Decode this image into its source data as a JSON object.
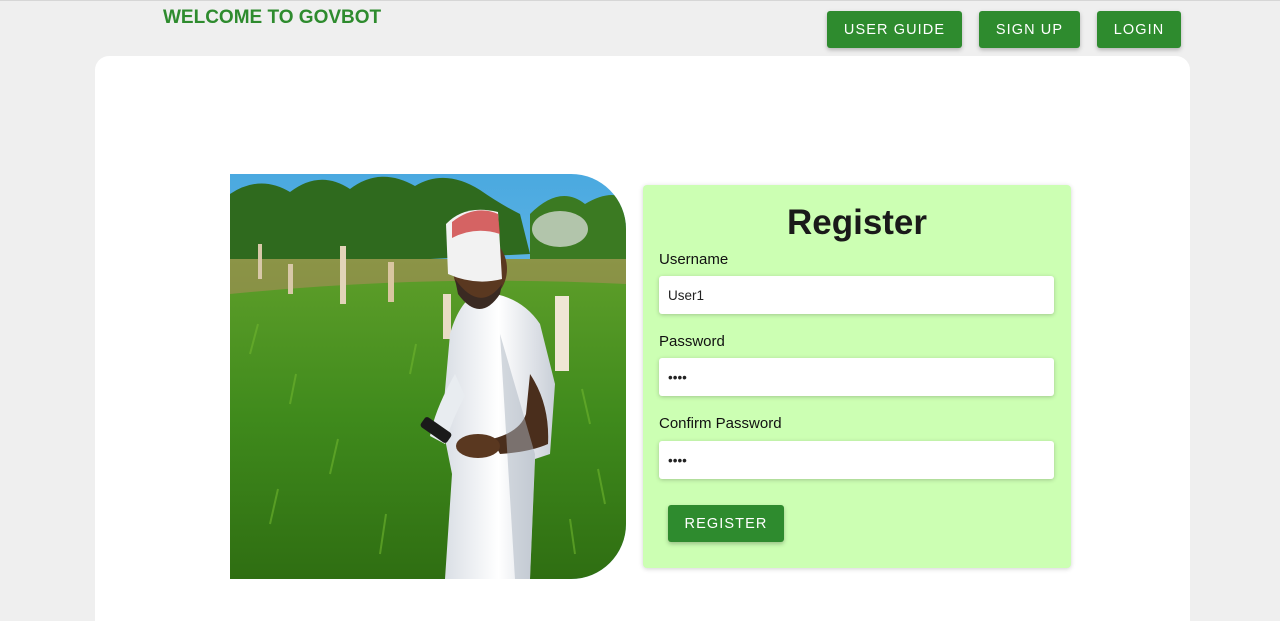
{
  "header": {
    "brand": "WELCOME TO GOVBOT",
    "nav": {
      "user_guide": "USER GUIDE",
      "sign_up": "SIGN UP",
      "login": "LOGIN"
    }
  },
  "register_form": {
    "title": "Register",
    "username": {
      "label": "Username",
      "value": "User1"
    },
    "password": {
      "label": "Password",
      "value": "••••"
    },
    "confirm_password": {
      "label": "Confirm Password",
      "value": "••••"
    },
    "submit_label": "REGISTER"
  },
  "colors": {
    "accent_green": "#2e8b2e",
    "form_panel_bg": "#ccffb3",
    "page_bg": "#efefef"
  }
}
